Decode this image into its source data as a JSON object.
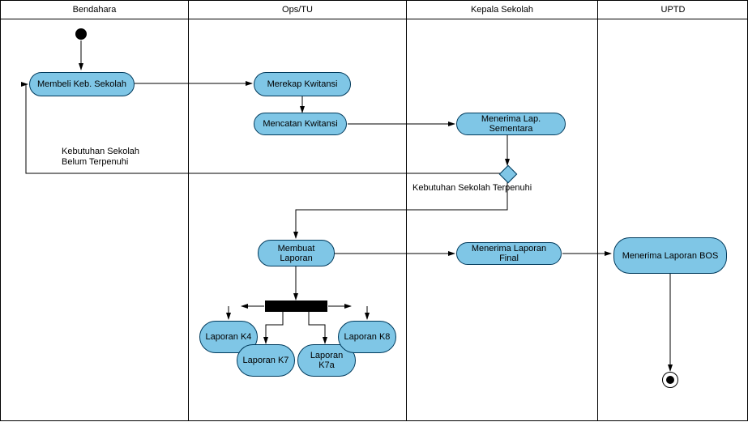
{
  "lanes": {
    "bendahara": "Bendahara",
    "ops": "Ops/TU",
    "kepala": "Kepala Sekolah",
    "uptd": "UPTD"
  },
  "nodes": {
    "membeli": "Membeli Keb. Sekolah",
    "merekap": "Merekap Kwitansi",
    "mencatan": "Mencatan Kwitansi",
    "menerima_sem": "Menerima Lap. Sementara",
    "membuat": "Membuat Laporan",
    "laporan_k4": "Laporan K4",
    "laporan_k7": "Laporan K7",
    "laporan_k7a": "Laporan K7a",
    "laporan_k8": "Laporan K8",
    "menerima_final": "Menerima Laporan Final",
    "menerima_bos": "Menerima Laporan BOS"
  },
  "guards": {
    "belum": "Kebutuhan Sekolah\nBelum Terpenuhi",
    "terpenuhi": "Kebutuhan Sekolah Terpenuhi"
  }
}
